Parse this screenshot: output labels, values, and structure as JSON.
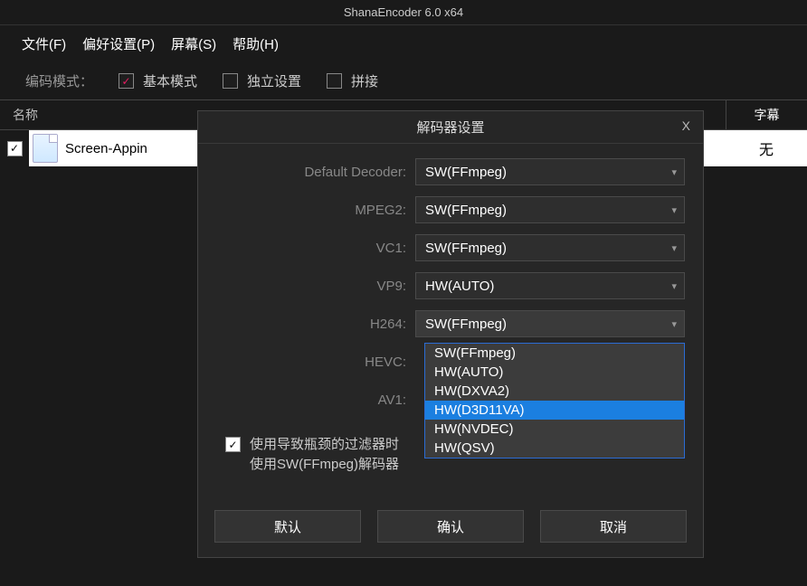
{
  "window": {
    "title": "ShanaEncoder 6.0 x64"
  },
  "menubar": {
    "file": "文件(F)",
    "prefs": "偏好设置(P)",
    "screen": "屏幕(S)",
    "help": "帮助(H)"
  },
  "modebar": {
    "label": "编码模式：",
    "basic": "基本模式",
    "independent": "独立设置",
    "concat": "拼接"
  },
  "list": {
    "header_name": "名称",
    "header_subtitle": "字幕",
    "file_name": "Screen-Appin",
    "subtitle_none": "无"
  },
  "dialog": {
    "title": "解码器设置",
    "close": "X",
    "rows": {
      "default": {
        "label": "Default Decoder:",
        "value": "SW(FFmpeg)"
      },
      "mpeg2": {
        "label": "MPEG2:",
        "value": "SW(FFmpeg)"
      },
      "vc1": {
        "label": "VC1:",
        "value": "SW(FFmpeg)"
      },
      "vp9": {
        "label": "VP9:",
        "value": "HW(AUTO)"
      },
      "h264": {
        "label": "H264:",
        "value": "SW(FFmpeg)"
      },
      "hevc": {
        "label": "HEVC:",
        "value": ""
      },
      "av1": {
        "label": "AV1:",
        "value": ""
      }
    },
    "dropdown": {
      "options": [
        "SW(FFmpeg)",
        "HW(AUTO)",
        "HW(DXVA2)",
        "HW(D3D11VA)",
        "HW(NVDEC)",
        "HW(QSV)"
      ],
      "selected": "HW(D3D11VA)"
    },
    "footer_check_line1": "使用导致瓶颈的过滤器时",
    "footer_check_line2": "使用SW(FFmpeg)解码器",
    "buttons": {
      "default": "默认",
      "ok": "确认",
      "cancel": "取消"
    }
  }
}
